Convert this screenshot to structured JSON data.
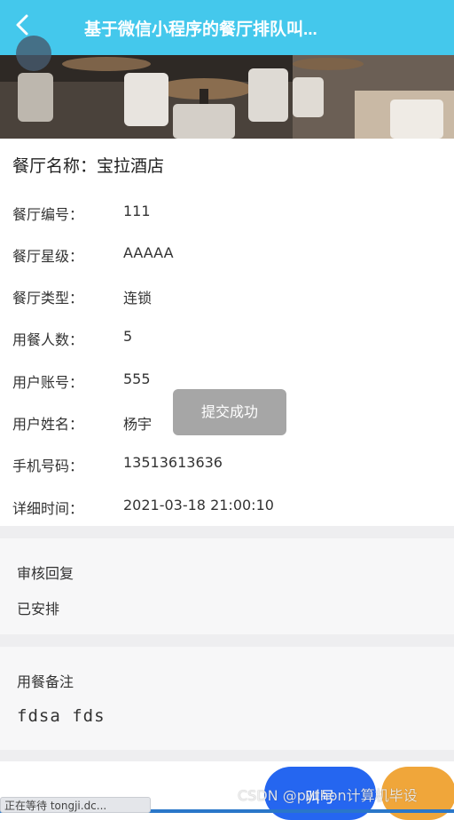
{
  "header": {
    "title": "基于微信小程序的餐厅排队叫...",
    "back_icon": "chevron-left-icon",
    "background": "#44c8ec"
  },
  "restaurant": {
    "name_label": "餐厅名称：",
    "name_value": "宝拉酒店"
  },
  "fields": [
    {
      "label": "餐厅编号：",
      "value": "111"
    },
    {
      "label": "餐厅星级：",
      "value": "AAAAA"
    },
    {
      "label": "餐厅类型：",
      "value": "连锁"
    },
    {
      "label": "用餐人数：",
      "value": "5"
    },
    {
      "label": "用户账号：",
      "value": "555"
    },
    {
      "label": "用户姓名：",
      "value": "杨宇"
    },
    {
      "label": "手机号码：",
      "value": "13513613636"
    },
    {
      "label": "详细时间：",
      "value": "2021-03-18 21:00:10"
    }
  ],
  "toast": {
    "text": "提交成功"
  },
  "review": {
    "label": "审核回复",
    "value": "已安排"
  },
  "remark": {
    "label": "用餐备注",
    "value": "fdsa fds"
  },
  "actions": {
    "primary_label": "叫号",
    "secondary_label": "",
    "primary_color": "#2566f0",
    "secondary_color": "#f0a63a"
  },
  "watermark": "CSDN @python计算机毕设",
  "status_bar": {
    "text": "正在等待 tongji.dc..."
  }
}
